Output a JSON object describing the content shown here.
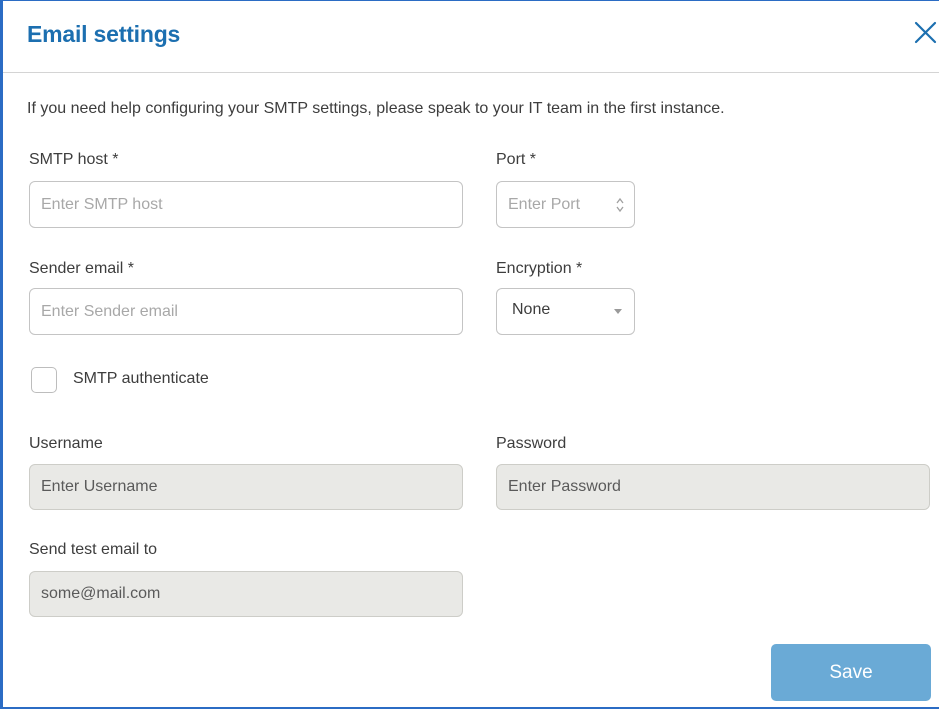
{
  "dialog": {
    "title": "Email settings",
    "close_icon": "close-icon",
    "help_text": "If you need help configuring your SMTP settings, please speak to your IT team in the first instance."
  },
  "smtp_host": {
    "label": "SMTP host *",
    "placeholder": "Enter SMTP host",
    "value": ""
  },
  "port": {
    "label": "Port *",
    "placeholder": "Enter Port",
    "value": "",
    "spinner_icon": "spinner-arrows-icon"
  },
  "sender_email": {
    "label": "Sender email *",
    "placeholder": "Enter Sender email",
    "value": ""
  },
  "encryption": {
    "label": "Encryption *",
    "selected": "None",
    "caret_icon": "caret-down-icon"
  },
  "smtp_authenticate": {
    "label": "SMTP authenticate",
    "checked": false
  },
  "username": {
    "label": "Username",
    "placeholder": "Enter Username",
    "disabled": true
  },
  "password": {
    "label": "Password",
    "placeholder": "Enter Password",
    "disabled": true
  },
  "test_email": {
    "label": "Send test email to",
    "value": "some@mail.com",
    "disabled": true
  },
  "actions": {
    "save_label": "Save"
  },
  "colors": {
    "title": "#1c6fb0",
    "accent_border": "#2b6cc4",
    "save_button": "#6aaad6",
    "disabled_field": "#e9e9e6"
  }
}
